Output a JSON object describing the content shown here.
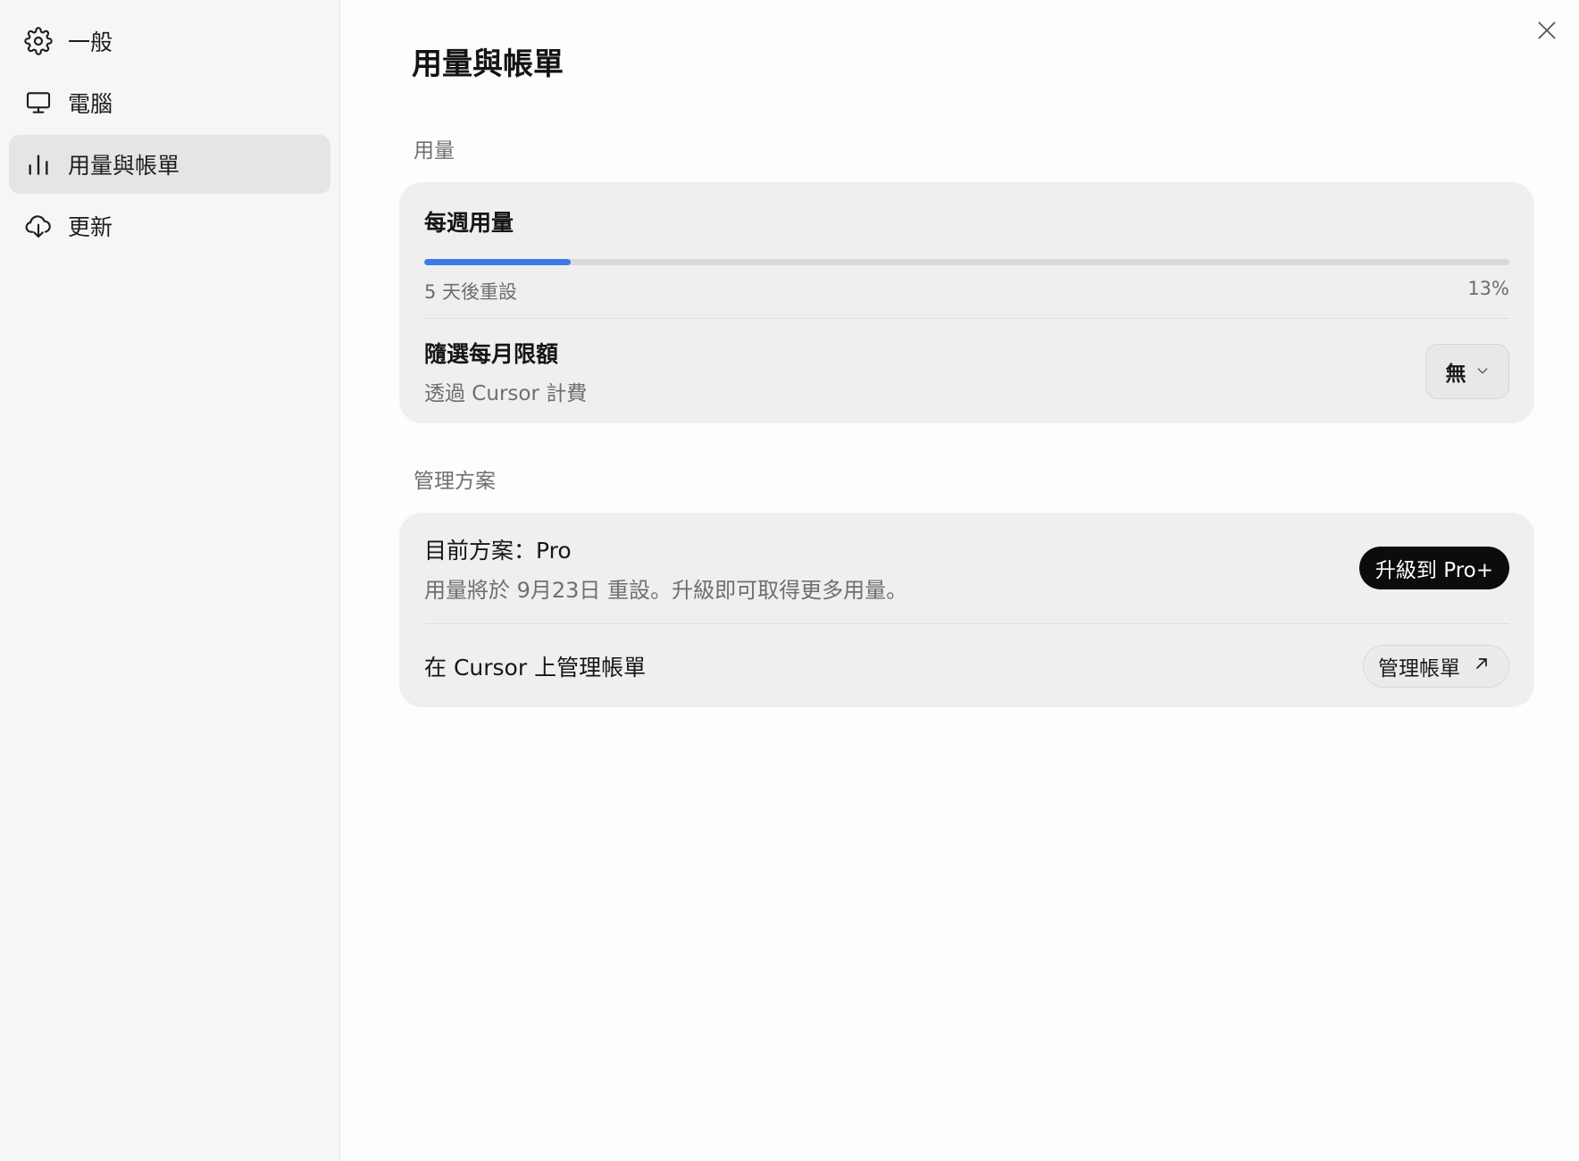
{
  "sidebar": {
    "items": [
      {
        "label": "一般",
        "icon": "gear-icon"
      },
      {
        "label": "電腦",
        "icon": "monitor-icon"
      },
      {
        "label": "用量與帳單",
        "icon": "bar-chart-icon",
        "active": true
      },
      {
        "label": "更新",
        "icon": "cloud-download-icon"
      }
    ]
  },
  "main": {
    "title": "用量與帳單",
    "usage_section": {
      "label": "用量",
      "weekly": {
        "title": "每週用量",
        "reset_text": "5 天後重設",
        "percent_text": "13%",
        "progress": 0.135
      },
      "monthly_limit": {
        "title": "隨選每月限額",
        "subtitle": "透過 Cursor 計費",
        "selected_value": "無"
      }
    },
    "plan_section": {
      "label": "管理方案",
      "current_plan": {
        "title": "目前方案：Pro",
        "subtitle": "用量將於 9月23日 重設。升級即可取得更多用量。",
        "upgrade_label": "升級到 Pro+"
      },
      "manage": {
        "title": "在 Cursor 上管理帳單",
        "button_label": "管理帳單"
      }
    }
  },
  "colors": {
    "accent": "#3b7be8",
    "sidebar_bg": "#f6f6f6",
    "card_bg": "#efefef",
    "active_item_bg": "#e5e5e5"
  }
}
